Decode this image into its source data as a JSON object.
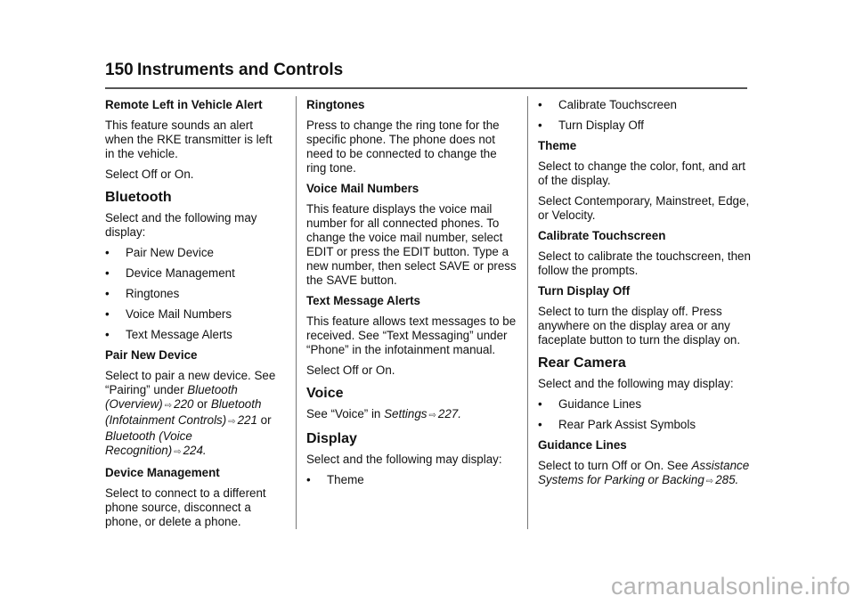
{
  "header": {
    "page_number": "150",
    "title": "Instruments and Controls"
  },
  "col1": {
    "remote_heading": "Remote Left in Vehicle Alert",
    "remote_p1": "This feature sounds an alert when the RKE transmitter is left in the vehicle.",
    "remote_p2": "Select Off or On.",
    "bluetooth_heading": "Bluetooth",
    "bluetooth_intro": "Select and the following may display:",
    "bluetooth_items": [
      "Pair New Device",
      "Device Management",
      "Ringtones",
      "Voice Mail Numbers",
      "Text Message Alerts"
    ],
    "pair_heading": "Pair New Device",
    "pair_p_a": "Select to pair a new device. See “Pairing” under ",
    "pair_ref1": "Bluetooth (Overview)",
    "pair_page1": "220",
    "pair_or1": " or ",
    "pair_ref2": "Bluetooth (Infotainment Controls)",
    "pair_page2": "221",
    "pair_or2": " or ",
    "pair_ref3": "Bluetooth (Voice Recognition)",
    "pair_page3": "224",
    "device_heading": "Device Management",
    "device_p": "Select to connect to a different phone source, disconnect a phone, or delete a phone."
  },
  "col2": {
    "ringtones_heading": "Ringtones",
    "ringtones_p": "Press to change the ring tone for the specific phone. The phone does not need to be connected to change the ring tone.",
    "voicemail_heading": "Voice Mail Numbers",
    "voicemail_p": "This feature displays the voice mail number for all connected phones. To change the voice mail number, select EDIT or press the EDIT button. Type a new number, then select SAVE or press the SAVE button.",
    "textmsg_heading": "Text Message Alerts",
    "textmsg_p": "This feature allows text messages to be received. See “Text Messaging” under “Phone” in the infotainment manual.",
    "textmsg_p2": "Select Off or On.",
    "voice_heading": "Voice",
    "voice_p_a": "See “Voice” in ",
    "voice_ref": "Settings",
    "voice_page": "227",
    "display_heading": "Display",
    "display_intro": "Select and the following may display:",
    "display_items": [
      "Theme"
    ]
  },
  "col3": {
    "display_items_cont": [
      "Calibrate Touchscreen",
      "Turn Display Off"
    ],
    "theme_heading": "Theme",
    "theme_p1": "Select to change the color, font, and art of the display.",
    "theme_p2": "Select Contemporary, Mainstreet, Edge, or Velocity.",
    "calibrate_heading": "Calibrate Touchscreen",
    "calibrate_p": "Select to calibrate the touchscreen, then follow the prompts.",
    "turnoff_heading": "Turn Display Off",
    "turnoff_p": "Select to turn the display off. Press anywhere on the display area or any faceplate button to turn the display on.",
    "rear_heading": "Rear Camera",
    "rear_intro": "Select and the following may display:",
    "rear_items": [
      "Guidance Lines",
      "Rear Park Assist Symbols"
    ],
    "guidance_heading": "Guidance Lines",
    "guidance_p_a": "Select to turn Off or On. See ",
    "guidance_ref": "Assistance Systems for Parking or Backing",
    "guidance_page": "285"
  },
  "icons": {
    "bullet": "•",
    "page_ref_arrow": "⇨"
  },
  "watermark": "carmanualsonline.info"
}
